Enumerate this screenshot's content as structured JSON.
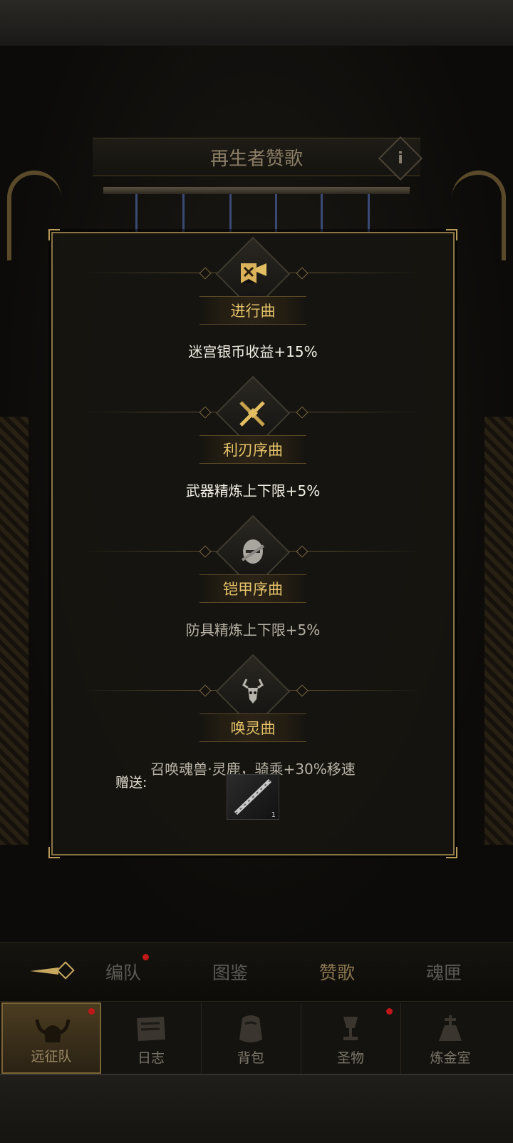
{
  "page": {
    "title": "再生者赞歌",
    "info_label": "i"
  },
  "popup": {
    "songs": [
      {
        "name": "进行曲",
        "effect": "迷宫银币收益+15%",
        "icon": "banner-trumpet-icon",
        "active": true
      },
      {
        "name": "利刃序曲",
        "effect": "武器精炼上下限+5%",
        "icon": "crossed-swords-icon",
        "active": true
      },
      {
        "name": "铠甲序曲",
        "effect": "防具精炼上下限+5%",
        "icon": "helmet-icon",
        "active": false
      },
      {
        "name": "唤灵曲",
        "effect": "召唤魂兽·灵鹿，骑乘+30%移速",
        "icon": "deer-head-icon",
        "active": false
      }
    ],
    "gift_label": "赠送:",
    "gift_item": {
      "icon": "flute-icon",
      "count": "1"
    }
  },
  "subtabs": {
    "back_icon": "back-arrow-icon",
    "items": [
      {
        "label": "编队",
        "badge": true
      },
      {
        "label": "图鉴",
        "badge": false
      },
      {
        "label": "赞歌",
        "badge": false,
        "active": true
      },
      {
        "label": "魂匣",
        "badge": false
      }
    ]
  },
  "nav": {
    "items": [
      {
        "label": "远征队",
        "icon": "horned-helmet-icon",
        "active": true,
        "badge": true
      },
      {
        "label": "日志",
        "icon": "scroll-icon",
        "active": false,
        "badge": false
      },
      {
        "label": "背包",
        "icon": "bag-icon",
        "active": false,
        "badge": false
      },
      {
        "label": "圣物",
        "icon": "chalice-icon",
        "active": false,
        "badge": true
      },
      {
        "label": "炼金室",
        "icon": "alchemy-icon",
        "active": false,
        "badge": false
      }
    ]
  },
  "colors": {
    "gold_text": "#e6c36a",
    "frame_gold": "#8b7444",
    "badge_red": "#c01818"
  }
}
